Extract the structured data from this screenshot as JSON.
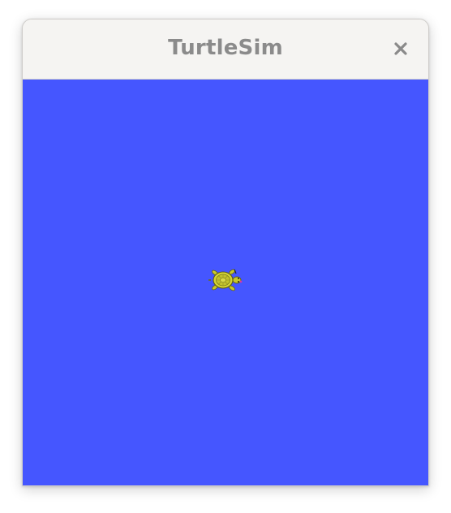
{
  "window": {
    "title": "TurtleSim",
    "close_icon": "close-icon"
  },
  "canvas": {
    "background_color": "#4556ff",
    "turtle_icon": "turtle-icon"
  }
}
